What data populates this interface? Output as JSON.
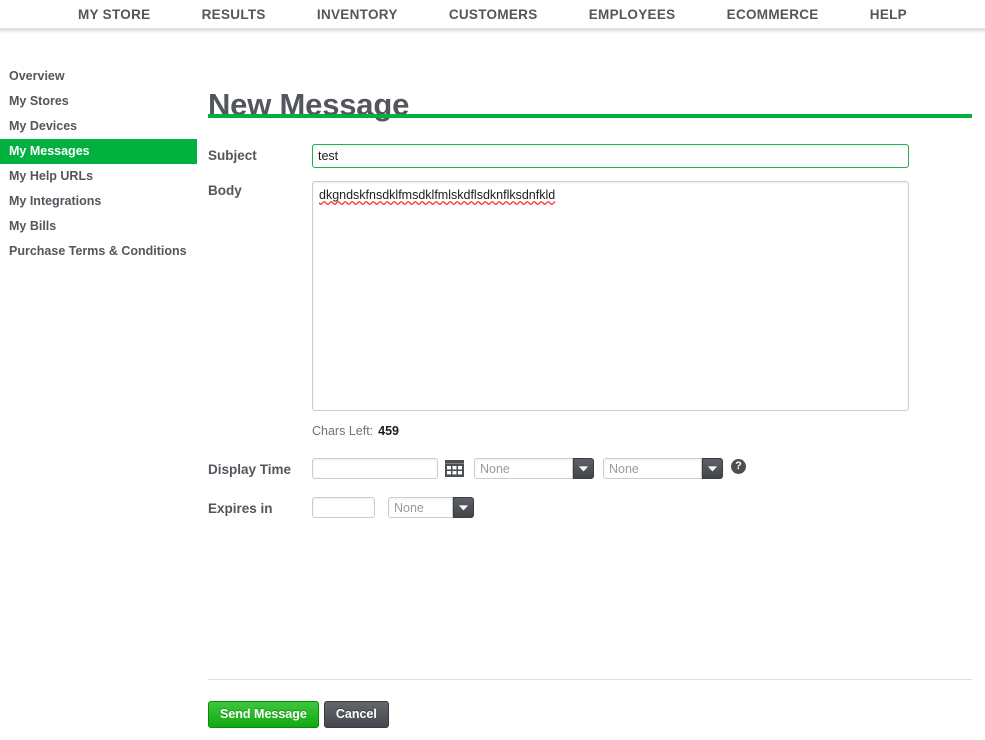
{
  "topnav": {
    "items": [
      {
        "label": "MY STORE",
        "name": "nav-my-store"
      },
      {
        "label": "RESULTS",
        "name": "nav-results"
      },
      {
        "label": "INVENTORY",
        "name": "nav-inventory"
      },
      {
        "label": "CUSTOMERS",
        "name": "nav-customers"
      },
      {
        "label": "EMPLOYEES",
        "name": "nav-employees"
      },
      {
        "label": "ECOMMERCE",
        "name": "nav-ecommerce"
      },
      {
        "label": "HELP",
        "name": "nav-help"
      }
    ]
  },
  "sidebar": {
    "items": [
      {
        "label": "Overview",
        "active": false
      },
      {
        "label": "My Stores",
        "active": false
      },
      {
        "label": "My Devices",
        "active": false
      },
      {
        "label": "My Messages",
        "active": true
      },
      {
        "label": "My Help URLs",
        "active": false
      },
      {
        "label": "My Integrations",
        "active": false
      },
      {
        "label": "My Bills",
        "active": false
      },
      {
        "label": "Purchase Terms & Conditions",
        "active": false
      }
    ]
  },
  "page": {
    "title": "New Message",
    "accent_color": "#00b140",
    "rule_color": "#00b140"
  },
  "form": {
    "subject": {
      "label": "Subject",
      "value": "test",
      "placeholder": "",
      "focused": true,
      "focus_border_color": "#1fb14c"
    },
    "body": {
      "label": "Body",
      "value": "dkgndskfnsdklfmsdklfmlskdflsdknflksdnfkld",
      "placeholder": "",
      "spellcheck_underline_color": "#ff2b2b"
    },
    "chars_left": {
      "label": "Chars Left:",
      "value": "459"
    },
    "display_time": {
      "label": "Display Time",
      "date_value": "",
      "date_placeholder": "",
      "calendar_icon": "calendar-icon",
      "hour_select": {
        "value": "None",
        "options": [
          "None"
        ]
      },
      "minute_select": {
        "value": "None",
        "options": [
          "None"
        ]
      },
      "help_icon": "help-icon",
      "help_glyph": "?"
    },
    "expires_in": {
      "label": "Expires in",
      "amount_value": "",
      "amount_placeholder": "",
      "unit_select": {
        "value": "None",
        "options": [
          "None"
        ]
      }
    }
  },
  "footer": {
    "send_label": "Send Message",
    "cancel_label": "Cancel",
    "send_color": "#0faa0f",
    "cancel_color": "#46484d"
  }
}
